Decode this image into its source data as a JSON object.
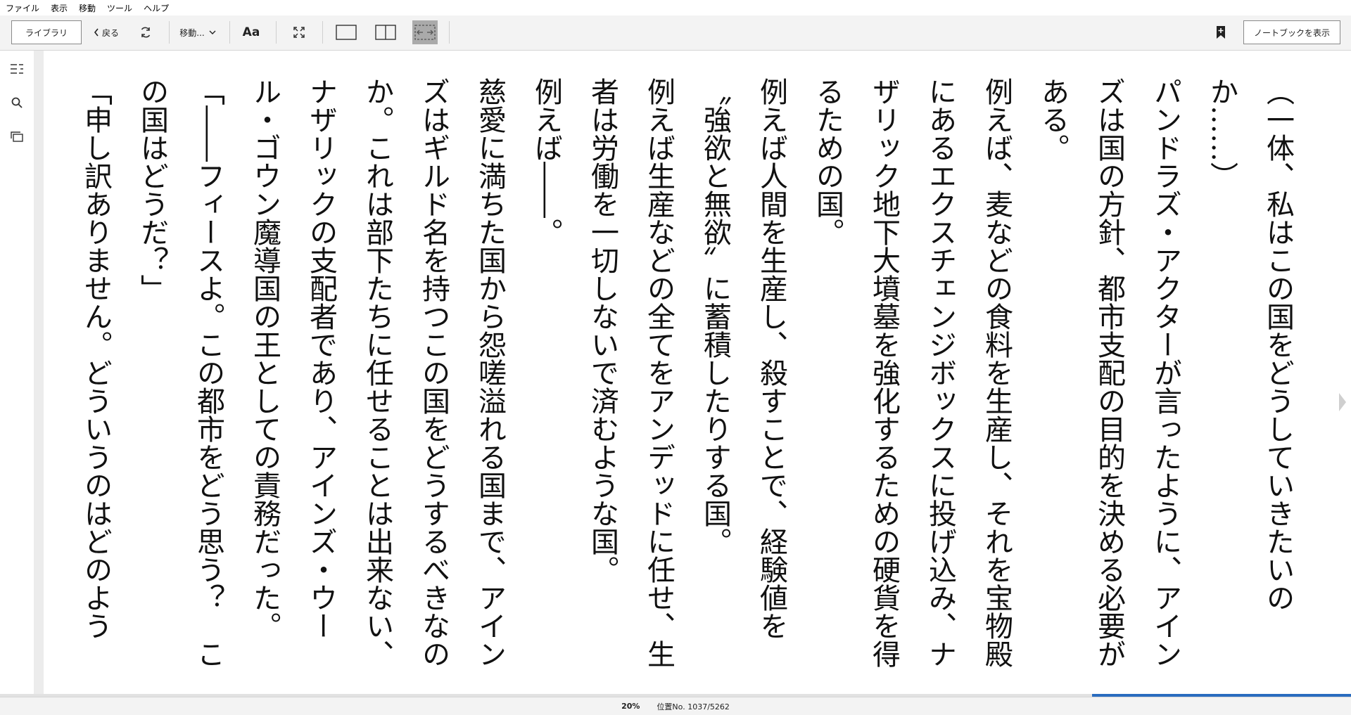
{
  "menu": [
    "ファイル",
    "表示",
    "移動",
    "ツール",
    "ヘルプ"
  ],
  "toolbar": {
    "library_label": "ライブラリ",
    "back_label": "戻る",
    "move_label": "移動...",
    "font_label": "Aa",
    "notebook_label": "ノートブックを表示"
  },
  "rail": {
    "icons": [
      "toc-icon",
      "search-icon",
      "flashcards-icon"
    ]
  },
  "reader": {
    "paragraphs": [
      "（一体、私はこの国をどうしていきたいのか……）",
      "パンドラズ・アクターが言ったように、アインズは国の方針、都市支配の目的を決める必要がある。",
      "例えば、麦などの食料を生産し、それを宝物殿にあるエクスチェンジボックスに投げ込み、ナザリック地下大墳墓を強化するための硬貨を得るための国。",
      "例えば人間を生産し、殺すことで、経験値を〝強欲と無欲〟に蓄積したりする国。",
      "例えば生産などの全てをアンデッドに任せ、生者は労働を一切しないで済むような国。",
      "例えば――。",
      "慈愛に満ちた国から怨嗟溢れる国まで、アインズはギルド名を持つこの国をどうするべきなのか。これは部下たちに任せることは出来ない、ナザリックの支配者であり、アインズ・ウール・ゴウン魔導国の王としての責務だった。",
      "「――フィースよ。この都市をどう思う？　この国はどうだ？」",
      "「申し訳ありません。どういうのはどのよう"
    ]
  },
  "status": {
    "percent": "20%",
    "position": "位置No. 1037/5262",
    "progress_fraction": 0.2
  }
}
